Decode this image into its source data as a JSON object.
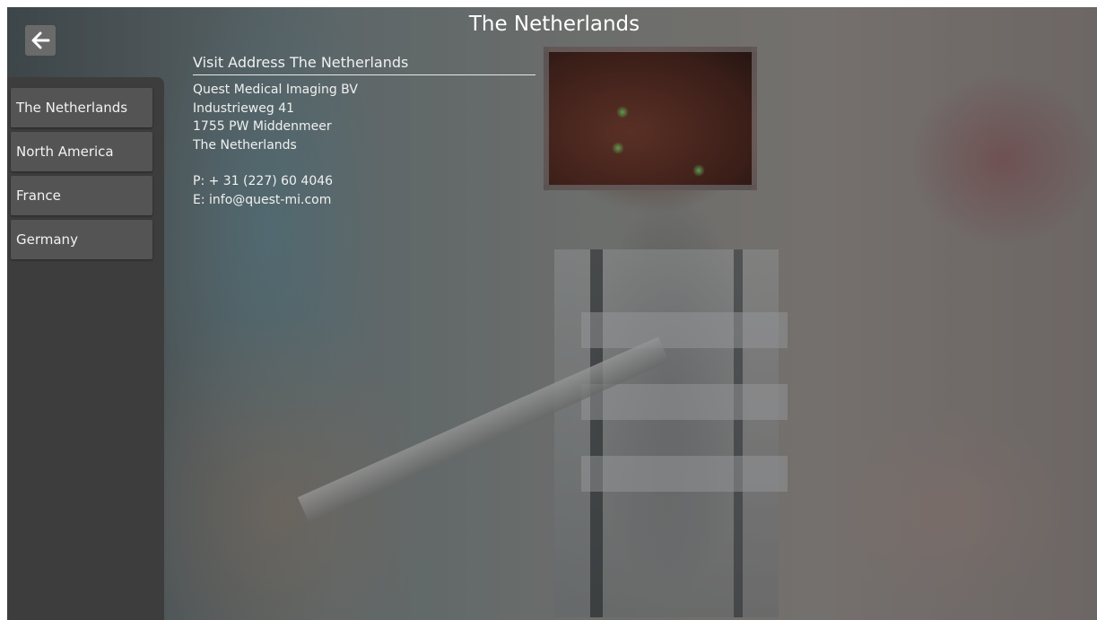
{
  "page": {
    "title": "The Netherlands"
  },
  "icons": {
    "back": "arrow-left-icon"
  },
  "sidebar": {
    "items": [
      {
        "label": "The Netherlands"
      },
      {
        "label": "North America"
      },
      {
        "label": "France"
      },
      {
        "label": "Germany"
      }
    ]
  },
  "contact": {
    "heading": "Visit Address The Netherlands",
    "company": "Quest Medical Imaging BV",
    "street": "Industrieweg 41",
    "postal_city": "1755 PW Middenmeer",
    "country": "The Netherlands",
    "phone": "P: + 31 (227) 60 4046",
    "email": "E: info@quest-mi.com"
  },
  "colors": {
    "sidebar_bg": "#3d3d3d",
    "nav_item_bg": "#545454",
    "back_button_bg": "#6a6a6a",
    "text": "#ffffff"
  }
}
